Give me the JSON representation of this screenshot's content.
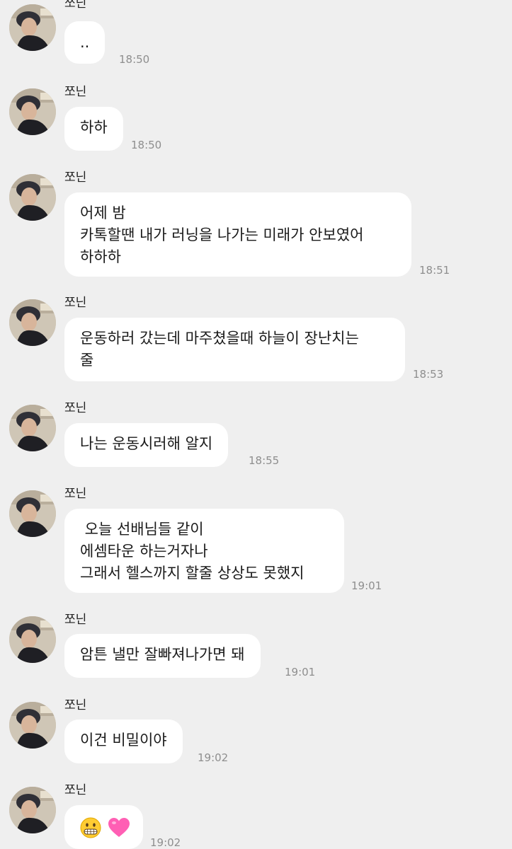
{
  "chat": {
    "messages": [
      {
        "sender": "쪼닌",
        "lines": [
          ".."
        ],
        "time": "18:50"
      },
      {
        "sender": "쪼닌",
        "lines": [
          "하하"
        ],
        "time": "18:50"
      },
      {
        "sender": "쪼닌",
        "lines": [
          "어제 밤",
          "카톡할땐 내가 러닝을 나가는 미래가 안보였어",
          "하하하"
        ],
        "time": "18:51"
      },
      {
        "sender": "쪼닌",
        "lines": [
          "운동하러 갔는데 마주쳤을때 하늘이 장난치는",
          "줄"
        ],
        "time": "18:53"
      },
      {
        "sender": "쪼닌",
        "lines": [
          "나는 운동시러해 알지"
        ],
        "time": "18:55"
      },
      {
        "sender": "쪼닌",
        "lines": [
          " 오늘 선배님들 같이",
          "에셈타운 하는거자나",
          "그래서 헬스까지 할줄 상상도 못했지"
        ],
        "time": "19:01"
      },
      {
        "sender": "쪼닌",
        "lines": [
          "암튼 낼만 잘빠져나가면 돼"
        ],
        "time": "19:01"
      },
      {
        "sender": "쪼닌",
        "lines": [
          "이건 비밀이야"
        ],
        "time": "19:02"
      },
      {
        "sender": "쪼닌",
        "emoji": [
          "grimacing-face-emoji",
          "pink-heart-emoji"
        ],
        "time": "19:02"
      }
    ]
  },
  "colors": {
    "background": "#efefef",
    "bubble": "#ffffff",
    "text": "#1a1a1a",
    "time": "#8e8e8e"
  }
}
